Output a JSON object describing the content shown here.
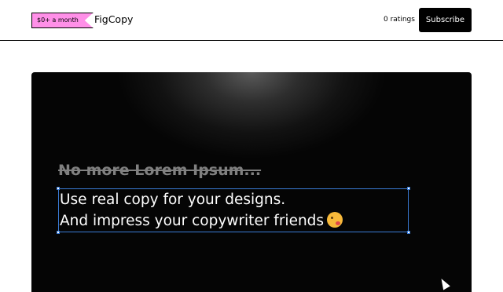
{
  "header": {
    "price_badge": "$0+ a month",
    "product_name": "FigCopy",
    "ratings": "0 ratings",
    "subscribe_label": "Subscribe"
  },
  "cover": {
    "strike_text": "No more Lorem Ipsum...",
    "copy_line_1": "Use real copy for your designs.",
    "copy_line_2": "And impress your copywriter friends",
    "emoji_icon": "kissing-face-emoji-icon"
  }
}
